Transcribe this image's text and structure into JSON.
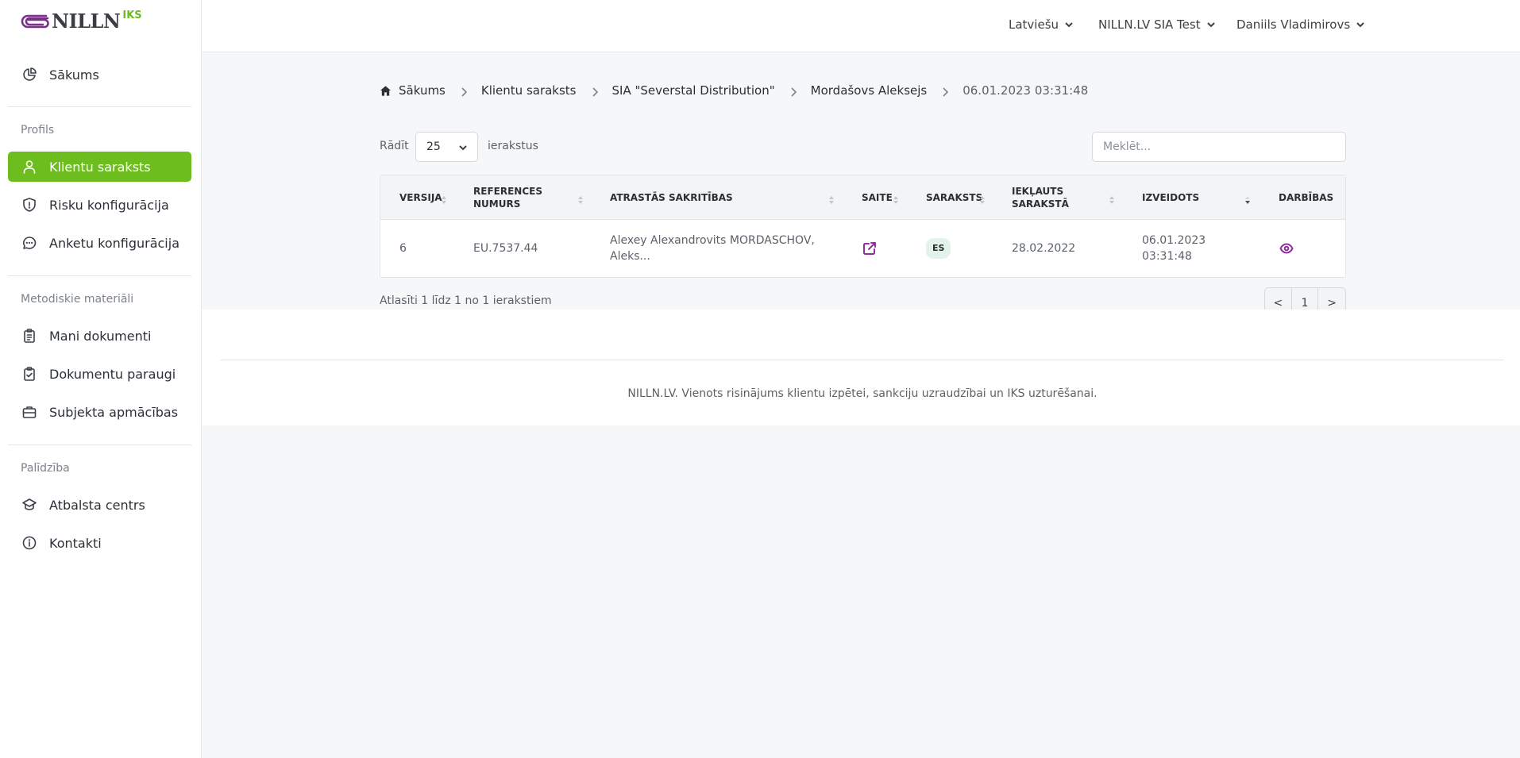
{
  "brand": {
    "name": "NILLN",
    "sup": "IKS",
    "accent": "#6dbd1f",
    "logo_color": "#7a2f88"
  },
  "sidebar": {
    "home": {
      "label": "Sākums",
      "icon": "pie-chart-icon"
    },
    "sections": [
      {
        "title": "Profils",
        "items": [
          {
            "label": "Klientu saraksts",
            "icon": "user-icon",
            "active": true
          },
          {
            "label": "Risku konfigurācija",
            "icon": "shield-icon"
          },
          {
            "label": "Anketu konfigurācija",
            "icon": "chat-icon"
          }
        ]
      },
      {
        "title": "Metodiskie materiāli",
        "items": [
          {
            "label": "Mani dokumenti",
            "icon": "clipboard-icon"
          },
          {
            "label": "Dokumentu paraugi",
            "icon": "clipboard-check-icon"
          },
          {
            "label": "Subjekta apmācības",
            "icon": "briefcase-icon"
          }
        ]
      },
      {
        "title": "Palīdzība",
        "items": [
          {
            "label": "Atbalsta centrs",
            "icon": "graduation-cap-icon"
          },
          {
            "label": "Kontakti",
            "icon": "info-icon"
          }
        ]
      }
    ]
  },
  "topbar": {
    "language": "Latviešu",
    "company": "NILLN.LV SIA Test",
    "user": "Daniils Vladimirovs"
  },
  "breadcrumb": [
    "Sākums",
    "Klientu saraksts",
    "SIA \"Severstal Distribution\"",
    "Mordašovs Aleksejs",
    "06.01.2023 03:31:48"
  ],
  "controls": {
    "show_label": "Rādīt",
    "page_size": "25",
    "entries_label": "ierakstus",
    "search_placeholder": "Meklēt..."
  },
  "table": {
    "headers": [
      "Versija",
      "References numurs",
      "Atrastās sakritības",
      "Saite",
      "Saraksts",
      "Iekļauts sarakstā",
      "Izveidots",
      "Darbības"
    ],
    "sort": {
      "column": "Izveidots",
      "direction": "desc"
    },
    "rows": [
      {
        "version": "6",
        "reference": "EU.7537.44",
        "matches": "Alexey Alexandrovits MORDASCHOV, Aleks...",
        "link_icon": "external-link-icon",
        "list": "ES",
        "included": "28.02.2022",
        "created": "06.01.2023 03:31:48",
        "action_icon": "eye-icon"
      }
    ]
  },
  "pagination": {
    "info": "Atlasīti 1 līdz 1 no 1 ierakstiem",
    "prev": "<",
    "current": "1",
    "next": ">"
  },
  "footer": "NILLN.LV. Vienots risinājums klientu izpētei, sankciju uzraudzībai un IKS uzturēšanai."
}
